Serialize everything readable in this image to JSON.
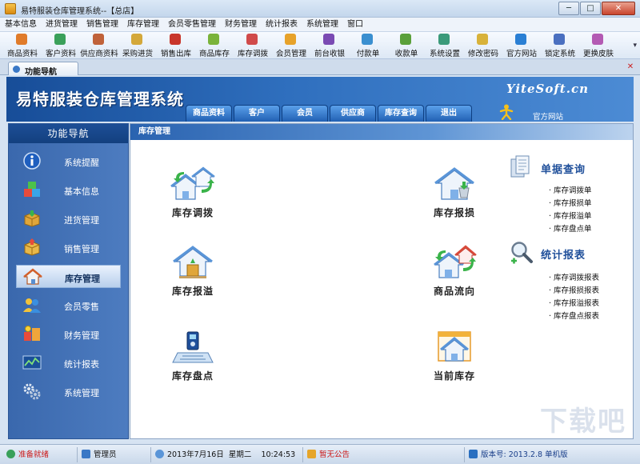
{
  "window": {
    "title": "易特服装仓库管理系统--【总店】",
    "minimize": "─",
    "maximize": "□",
    "close": "✕"
  },
  "menu": [
    "基本信息",
    "进货管理",
    "销售管理",
    "库存管理",
    "会员零售管理",
    "财务管理",
    "统计报表",
    "系统管理",
    "窗口"
  ],
  "toolbar": [
    {
      "label": "商品资料",
      "color": "#e07b2a"
    },
    {
      "label": "客户资料",
      "color": "#3aa05a"
    },
    {
      "label": "供应商资料",
      "color": "#c0623a"
    },
    {
      "label": "采购进货",
      "color": "#d4a83a"
    },
    {
      "label": "销售出库",
      "color": "#c8352a"
    },
    {
      "label": "商品库存",
      "color": "#7ab33a"
    },
    {
      "label": "库存调拨",
      "color": "#d04a4a"
    },
    {
      "label": "会员管理",
      "color": "#e7a22a"
    },
    {
      "label": "前台收银",
      "color": "#7a4ab3"
    },
    {
      "label": "付款单",
      "color": "#3a8fd0"
    },
    {
      "label": "收款单",
      "color": "#5aa03a"
    },
    {
      "label": "系统设置",
      "color": "#3a9a7a"
    },
    {
      "label": "修改密码",
      "color": "#d8b23a"
    },
    {
      "label": "官方网站",
      "color": "#2a7fd4"
    },
    {
      "label": "锁定系统",
      "color": "#4a6fc0"
    },
    {
      "label": "更换皮肤",
      "color": "#b35ab3"
    }
  ],
  "tab": {
    "label": "功能导航"
  },
  "banner": {
    "title": "易特服装仓库管理系统",
    "brand": "YiteSoft.cn",
    "official": "官方网站",
    "tabs": [
      "商品资料",
      "客户",
      "会员",
      "供应商",
      "库存查询",
      "退出"
    ]
  },
  "sidebar": {
    "header": "功能导航",
    "items": [
      {
        "label": "系统提醒",
        "icon": "info-icon"
      },
      {
        "label": "基本信息",
        "icon": "cubes-icon"
      },
      {
        "label": "进货管理",
        "icon": "box-in-icon"
      },
      {
        "label": "销售管理",
        "icon": "box-out-icon"
      },
      {
        "label": "库存管理",
        "icon": "house-icon",
        "active": true
      },
      {
        "label": "会员零售",
        "icon": "users-icon"
      },
      {
        "label": "财务管理",
        "icon": "finance-icon"
      },
      {
        "label": "统计报表",
        "icon": "chart-icon"
      },
      {
        "label": "系统管理",
        "icon": "gears-icon"
      }
    ]
  },
  "main": {
    "header": "库存管理",
    "functions": [
      {
        "label": "库存调拨",
        "icon": "transfer-warehouse-icon"
      },
      {
        "label": "库存报损",
        "icon": "loss-warehouse-icon"
      },
      {
        "label": "库存报溢",
        "icon": "overflow-warehouse-icon"
      },
      {
        "label": "商品流向",
        "icon": "flow-warehouse-icon"
      },
      {
        "label": "库存盘点",
        "icon": "inventory-icon"
      },
      {
        "label": "当前库存",
        "icon": "current-stock-icon"
      }
    ],
    "queries": {
      "title": "单据查询",
      "links": [
        "库存调拨单",
        "库存报损单",
        "库存报溢单",
        "库存盘点单"
      ]
    },
    "reports": {
      "title": "统计报表",
      "links": [
        "库存调拨报表",
        "库存报损报表",
        "库存报溢报表",
        "库存盘点报表"
      ]
    },
    "watermark": "下载吧"
  },
  "status": {
    "ready": "准备就绪",
    "user": "管理员",
    "date": "2013年7月16日",
    "weekday": "星期二",
    "time": "10:24:53",
    "notice": "暂无公告",
    "version": "版本号: 2013.2.8",
    "mode": "单机版"
  }
}
